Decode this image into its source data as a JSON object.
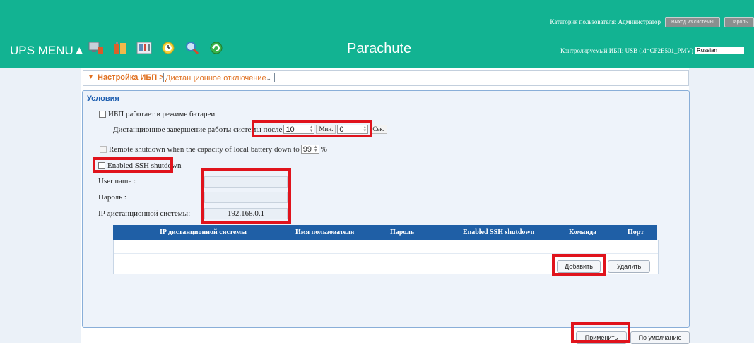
{
  "header": {
    "user_category": "Категория пользователя: Администратор",
    "logout_label": "Выход из системы",
    "password_label": "Пароль",
    "ups_menu": "UPS MENU▲",
    "brand": "Parachute",
    "monitored_ups": "Контролируемый ИБП: USB (id=CF2E501_PMV)",
    "language": "Russian",
    "icons": [
      "monitor-icon",
      "battery-icon",
      "tools-icon",
      "clock-icon",
      "search-icon",
      "refresh-icon"
    ]
  },
  "breadcrumb": {
    "arrow": "▾",
    "section": "Настройка ИБП >>",
    "page_select": "Дистанционное отключение"
  },
  "conditions": {
    "title": "Условия",
    "on_battery_label": "ИБП работает в режиме батареи",
    "remote_shutdown_label": "Дистанционное завершение работы системы после",
    "minutes_value": "10",
    "minutes_unit": "Мин.",
    "seconds_value": "0",
    "seconds_unit": "Сек.",
    "capacity_label": "Remote shutdown when the capacity of local battery down to",
    "capacity_value": "99",
    "capacity_unit": "%",
    "ssh_label": "Enabled SSH shutdown",
    "username_label": "User name :",
    "username_value": "",
    "password_label": "Пароль :",
    "password_value": "",
    "remote_ip_label": "IP дистанционной системы:",
    "remote_ip_value": "192.168.0.1"
  },
  "table": {
    "columns": [
      "IP дистанционной системы",
      "Имя пользователя",
      "Пароль",
      "Enabled SSH shutdown",
      "Команда",
      "Порт"
    ],
    "rows": []
  },
  "buttons": {
    "add": "Добавить",
    "delete": "Удалить",
    "apply": "Применить",
    "default": "По умолчанию"
  },
  "colors": {
    "header_bg": "#12b392",
    "accent_orange": "#e07020",
    "table_header": "#1f5fa6",
    "highlight_red": "#e0131c"
  }
}
